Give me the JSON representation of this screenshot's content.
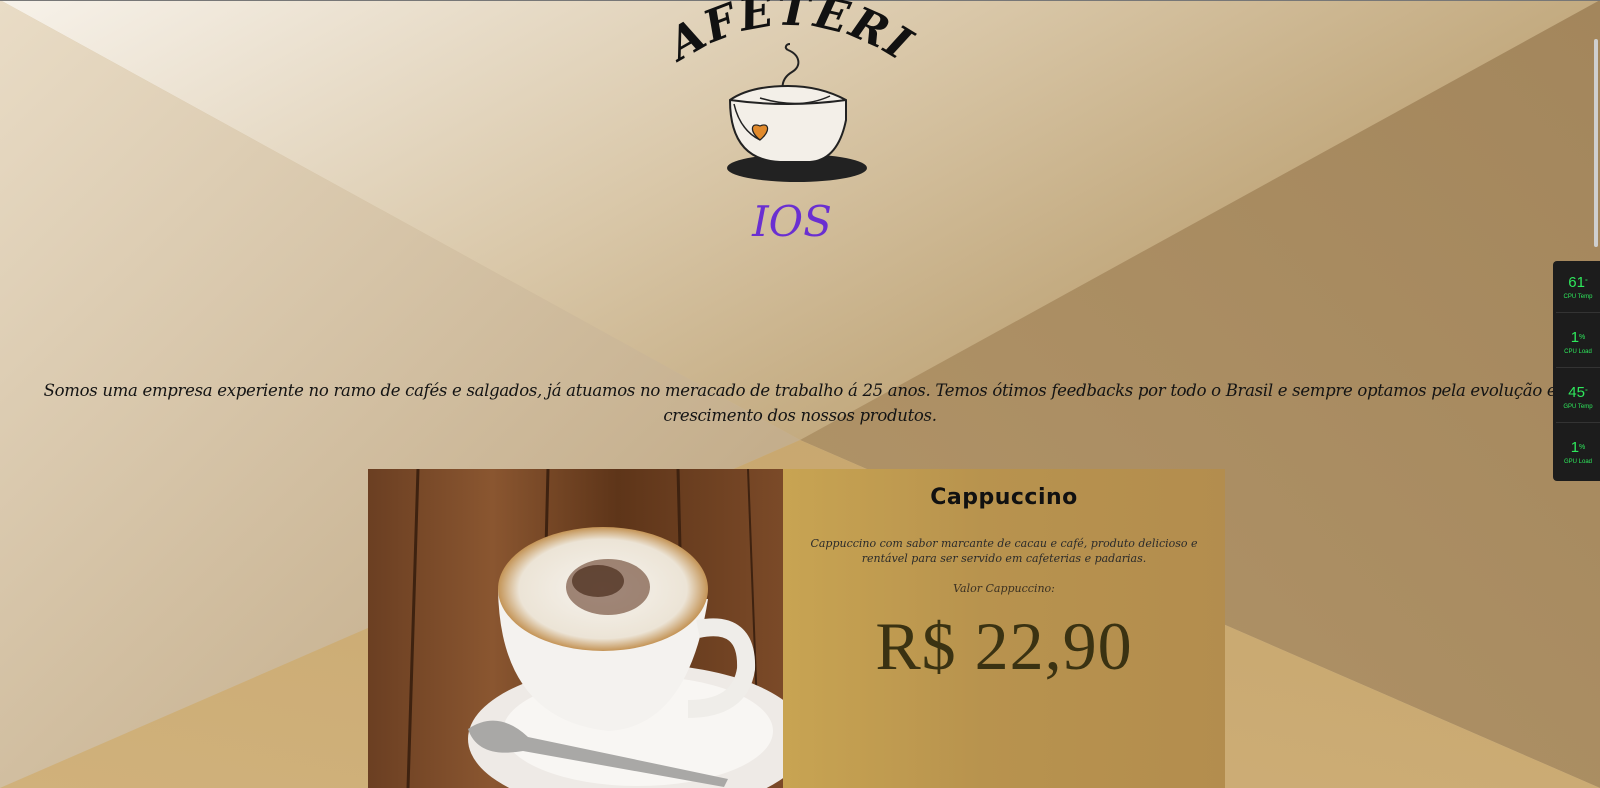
{
  "logo": {
    "brand_text": "CAFETERIA",
    "sub_text": "IOS",
    "sub_color": "#6a2fd1",
    "heart_color": "#e18a2c"
  },
  "about": {
    "text": "Somos uma empresa experiente no ramo de cafés e salgados, já atuamos no meracado de trabalho á 25 anos. Temos ótimos feedbacks por todo o Brasil e sempre optamos pela evolução e crescimento dos nossos produtos."
  },
  "product": {
    "title": "Cappuccino",
    "description": "Cappuccino com sabor marcante de cacau e café, produto delicioso e rentável para ser servido em cafeterias e padarias.",
    "price_label": "Valor Cappuccino:",
    "price": "R$ 22,90",
    "image_icon": "cappuccino-photo"
  },
  "monitor": {
    "items": [
      {
        "value": "61",
        "unit": "°",
        "label": "CPU Temp"
      },
      {
        "value": "1",
        "unit": "%",
        "label": "CPU Load"
      },
      {
        "value": "45",
        "unit": "°",
        "label": "GPU Temp"
      },
      {
        "value": "1",
        "unit": "%",
        "label": "GPU Load"
      }
    ]
  }
}
